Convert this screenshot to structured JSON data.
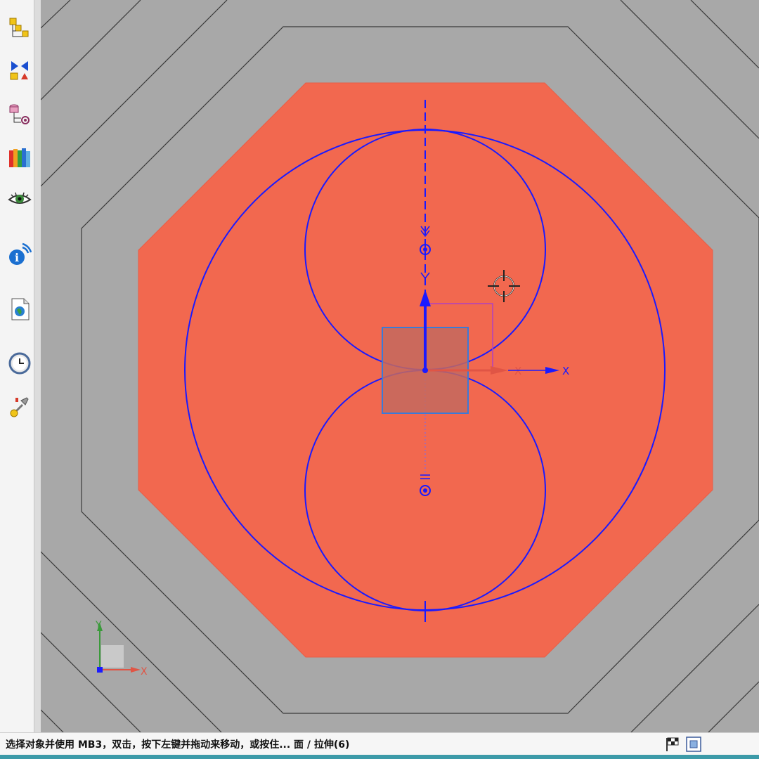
{
  "toolbar": {
    "items": [
      {
        "icon": "assembly-navigator-icon"
      },
      {
        "icon": "constraint-navigator-icon"
      },
      {
        "icon": "part-navigator-icon"
      },
      {
        "icon": "reuse-library-icon"
      },
      {
        "icon": "visualization-eye-icon"
      },
      {
        "icon": "information-icon"
      },
      {
        "icon": "web-browser-icon"
      },
      {
        "icon": "history-clock-icon"
      },
      {
        "icon": "process-studio-icon"
      }
    ]
  },
  "viewport": {
    "colors": {
      "background": "#a8a8a8",
      "face": "#f2684f",
      "sketch": "#1a1aff",
      "selection": "#c46a5e"
    },
    "sketch_csys": {
      "x_label": "X",
      "x_label_secondary": "X"
    },
    "triad": {
      "y_label": "Y",
      "x_label": "X"
    }
  },
  "statusbar": {
    "message": "选择对象并使用 MB3，双击，按下左键并拖动来移动，或按住... 面 / 拉伸(6)",
    "icons": [
      "finish-sketch-flag-icon",
      "fit-view-icon"
    ]
  }
}
